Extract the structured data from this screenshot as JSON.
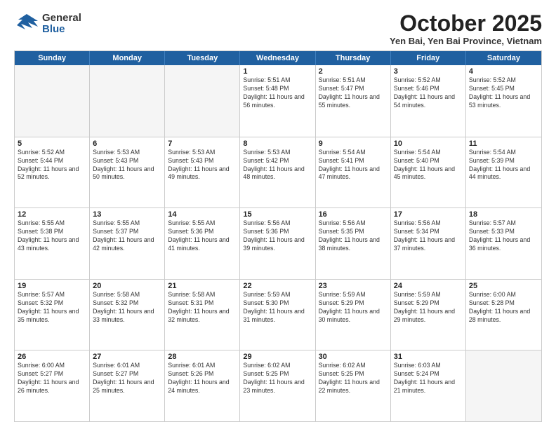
{
  "logo": {
    "general": "General",
    "blue": "Blue"
  },
  "header": {
    "month": "October 2025",
    "location": "Yen Bai, Yen Bai Province, Vietnam"
  },
  "weekdays": [
    "Sunday",
    "Monday",
    "Tuesday",
    "Wednesday",
    "Thursday",
    "Friday",
    "Saturday"
  ],
  "weeks": [
    [
      {
        "day": "",
        "sunrise": "",
        "sunset": "",
        "daylight": ""
      },
      {
        "day": "",
        "sunrise": "",
        "sunset": "",
        "daylight": ""
      },
      {
        "day": "",
        "sunrise": "",
        "sunset": "",
        "daylight": ""
      },
      {
        "day": "1",
        "sunrise": "Sunrise: 5:51 AM",
        "sunset": "Sunset: 5:48 PM",
        "daylight": "Daylight: 11 hours and 56 minutes."
      },
      {
        "day": "2",
        "sunrise": "Sunrise: 5:51 AM",
        "sunset": "Sunset: 5:47 PM",
        "daylight": "Daylight: 11 hours and 55 minutes."
      },
      {
        "day": "3",
        "sunrise": "Sunrise: 5:52 AM",
        "sunset": "Sunset: 5:46 PM",
        "daylight": "Daylight: 11 hours and 54 minutes."
      },
      {
        "day": "4",
        "sunrise": "Sunrise: 5:52 AM",
        "sunset": "Sunset: 5:45 PM",
        "daylight": "Daylight: 11 hours and 53 minutes."
      }
    ],
    [
      {
        "day": "5",
        "sunrise": "Sunrise: 5:52 AM",
        "sunset": "Sunset: 5:44 PM",
        "daylight": "Daylight: 11 hours and 52 minutes."
      },
      {
        "day": "6",
        "sunrise": "Sunrise: 5:53 AM",
        "sunset": "Sunset: 5:43 PM",
        "daylight": "Daylight: 11 hours and 50 minutes."
      },
      {
        "day": "7",
        "sunrise": "Sunrise: 5:53 AM",
        "sunset": "Sunset: 5:43 PM",
        "daylight": "Daylight: 11 hours and 49 minutes."
      },
      {
        "day": "8",
        "sunrise": "Sunrise: 5:53 AM",
        "sunset": "Sunset: 5:42 PM",
        "daylight": "Daylight: 11 hours and 48 minutes."
      },
      {
        "day": "9",
        "sunrise": "Sunrise: 5:54 AM",
        "sunset": "Sunset: 5:41 PM",
        "daylight": "Daylight: 11 hours and 47 minutes."
      },
      {
        "day": "10",
        "sunrise": "Sunrise: 5:54 AM",
        "sunset": "Sunset: 5:40 PM",
        "daylight": "Daylight: 11 hours and 45 minutes."
      },
      {
        "day": "11",
        "sunrise": "Sunrise: 5:54 AM",
        "sunset": "Sunset: 5:39 PM",
        "daylight": "Daylight: 11 hours and 44 minutes."
      }
    ],
    [
      {
        "day": "12",
        "sunrise": "Sunrise: 5:55 AM",
        "sunset": "Sunset: 5:38 PM",
        "daylight": "Daylight: 11 hours and 43 minutes."
      },
      {
        "day": "13",
        "sunrise": "Sunrise: 5:55 AM",
        "sunset": "Sunset: 5:37 PM",
        "daylight": "Daylight: 11 hours and 42 minutes."
      },
      {
        "day": "14",
        "sunrise": "Sunrise: 5:55 AM",
        "sunset": "Sunset: 5:36 PM",
        "daylight": "Daylight: 11 hours and 41 minutes."
      },
      {
        "day": "15",
        "sunrise": "Sunrise: 5:56 AM",
        "sunset": "Sunset: 5:36 PM",
        "daylight": "Daylight: 11 hours and 39 minutes."
      },
      {
        "day": "16",
        "sunrise": "Sunrise: 5:56 AM",
        "sunset": "Sunset: 5:35 PM",
        "daylight": "Daylight: 11 hours and 38 minutes."
      },
      {
        "day": "17",
        "sunrise": "Sunrise: 5:56 AM",
        "sunset": "Sunset: 5:34 PM",
        "daylight": "Daylight: 11 hours and 37 minutes."
      },
      {
        "day": "18",
        "sunrise": "Sunrise: 5:57 AM",
        "sunset": "Sunset: 5:33 PM",
        "daylight": "Daylight: 11 hours and 36 minutes."
      }
    ],
    [
      {
        "day": "19",
        "sunrise": "Sunrise: 5:57 AM",
        "sunset": "Sunset: 5:32 PM",
        "daylight": "Daylight: 11 hours and 35 minutes."
      },
      {
        "day": "20",
        "sunrise": "Sunrise: 5:58 AM",
        "sunset": "Sunset: 5:32 PM",
        "daylight": "Daylight: 11 hours and 33 minutes."
      },
      {
        "day": "21",
        "sunrise": "Sunrise: 5:58 AM",
        "sunset": "Sunset: 5:31 PM",
        "daylight": "Daylight: 11 hours and 32 minutes."
      },
      {
        "day": "22",
        "sunrise": "Sunrise: 5:59 AM",
        "sunset": "Sunset: 5:30 PM",
        "daylight": "Daylight: 11 hours and 31 minutes."
      },
      {
        "day": "23",
        "sunrise": "Sunrise: 5:59 AM",
        "sunset": "Sunset: 5:29 PM",
        "daylight": "Daylight: 11 hours and 30 minutes."
      },
      {
        "day": "24",
        "sunrise": "Sunrise: 5:59 AM",
        "sunset": "Sunset: 5:29 PM",
        "daylight": "Daylight: 11 hours and 29 minutes."
      },
      {
        "day": "25",
        "sunrise": "Sunrise: 6:00 AM",
        "sunset": "Sunset: 5:28 PM",
        "daylight": "Daylight: 11 hours and 28 minutes."
      }
    ],
    [
      {
        "day": "26",
        "sunrise": "Sunrise: 6:00 AM",
        "sunset": "Sunset: 5:27 PM",
        "daylight": "Daylight: 11 hours and 26 minutes."
      },
      {
        "day": "27",
        "sunrise": "Sunrise: 6:01 AM",
        "sunset": "Sunset: 5:27 PM",
        "daylight": "Daylight: 11 hours and 25 minutes."
      },
      {
        "day": "28",
        "sunrise": "Sunrise: 6:01 AM",
        "sunset": "Sunset: 5:26 PM",
        "daylight": "Daylight: 11 hours and 24 minutes."
      },
      {
        "day": "29",
        "sunrise": "Sunrise: 6:02 AM",
        "sunset": "Sunset: 5:25 PM",
        "daylight": "Daylight: 11 hours and 23 minutes."
      },
      {
        "day": "30",
        "sunrise": "Sunrise: 6:02 AM",
        "sunset": "Sunset: 5:25 PM",
        "daylight": "Daylight: 11 hours and 22 minutes."
      },
      {
        "day": "31",
        "sunrise": "Sunrise: 6:03 AM",
        "sunset": "Sunset: 5:24 PM",
        "daylight": "Daylight: 11 hours and 21 minutes."
      },
      {
        "day": "",
        "sunrise": "",
        "sunset": "",
        "daylight": ""
      }
    ]
  ]
}
